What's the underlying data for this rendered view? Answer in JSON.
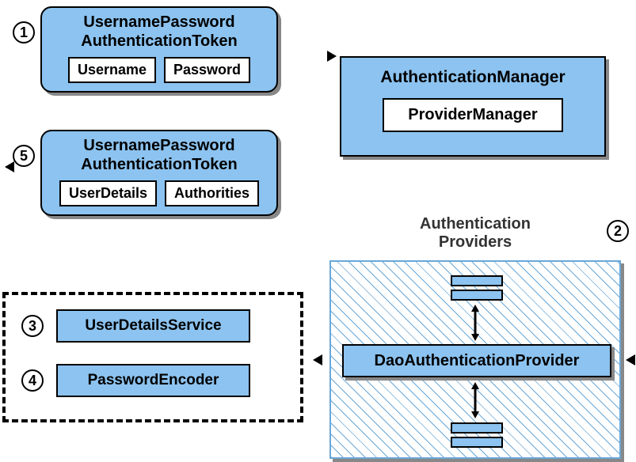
{
  "step1": {
    "num": "1",
    "title1": "UsernamePassword",
    "title2": "AuthenticationToken",
    "left": "Username",
    "right": "Password"
  },
  "step5": {
    "num": "5",
    "title1": "UsernamePassword",
    "title2": "AuthenticationToken",
    "left": "UserDetails",
    "right": "Authorities"
  },
  "authmgr": {
    "title": "AuthenticationManager",
    "inner": "ProviderManager"
  },
  "providers": {
    "label1": "Authentication",
    "label2": "Providers",
    "num": "2",
    "dao": "DaoAuthenticationProvider"
  },
  "step3": {
    "num": "3",
    "label": "UserDetailsService"
  },
  "step4": {
    "num": "4",
    "label": "PasswordEncoder"
  }
}
